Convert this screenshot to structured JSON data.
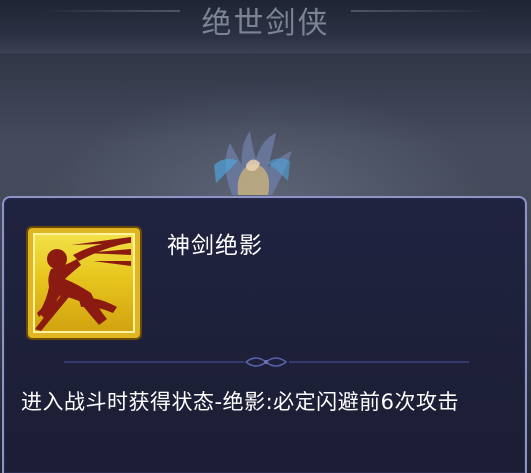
{
  "header": {
    "hero_name": "绝世剑侠"
  },
  "tooltip": {
    "skill_name": "神剑绝影",
    "description": "进入战斗时获得状态-绝影:必定闪避前6次攻击",
    "icon": "dashing-swordsman-icon"
  },
  "colors": {
    "panel_background": "#1d2038",
    "panel_border": "#8d93c4",
    "icon_gold": "#e0b522",
    "icon_figure": "#8b1a10",
    "text": "#ffffff"
  }
}
